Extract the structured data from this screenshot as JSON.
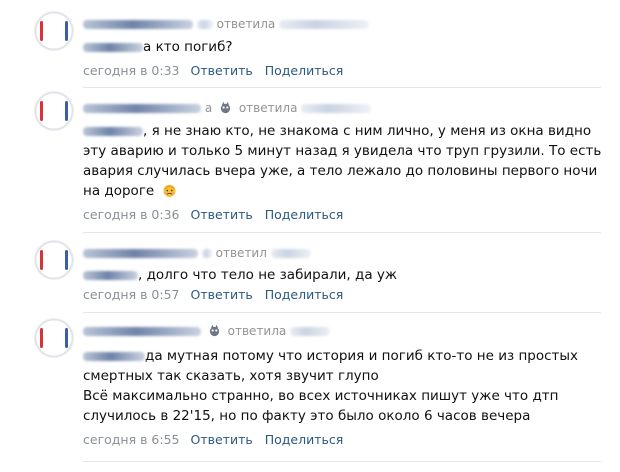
{
  "comments": [
    {
      "header_fragment": "ответила",
      "text_lines": [
        "а кто погиб?"
      ],
      "time": "сегодня в 0:33",
      "reply": "Ответить",
      "share": "Поделиться"
    },
    {
      "header_fragment": "ответила",
      "text_lines": [
        ", я не знаю кто, не знакома с ним лично, у меня из окна видно",
        "эту аварию и только 5 минут назад я увидела что труп грузили. То есть",
        "авария случилась вчера уже, а тело лежало до половины первого ночи",
        "на дороге"
      ],
      "emoji": "sad-face-emoji",
      "time": "сегодня в 0:36",
      "reply": "Ответить",
      "share": "Поделиться"
    },
    {
      "header_fragment": "ответил",
      "text_lines": [
        ", долго что тело не забирали, да уж"
      ],
      "time": "сегодня в 0:57",
      "reply": "Ответить",
      "share": "Поделиться"
    },
    {
      "header_fragment": "ответила",
      "text_lines": [
        "да мутная потому что история и погиб кто-то не из простых",
        "смертных так сказать, хотя звучит глупо",
        "Всё максимально странно, во всех источниках пишут уже что дтп",
        "случилось в 22'15, но по факту это было около 6 часов вечера"
      ],
      "time": "сегодня в 6:55",
      "reply": "Ответить",
      "share": "Поделиться"
    }
  ],
  "colors": {
    "link": "#2a5885",
    "muted": "#8a8f96",
    "separator": "#e3e6ea",
    "avatar_edge_red": "#d8323a",
    "avatar_edge_blue": "#3a5ea8"
  }
}
